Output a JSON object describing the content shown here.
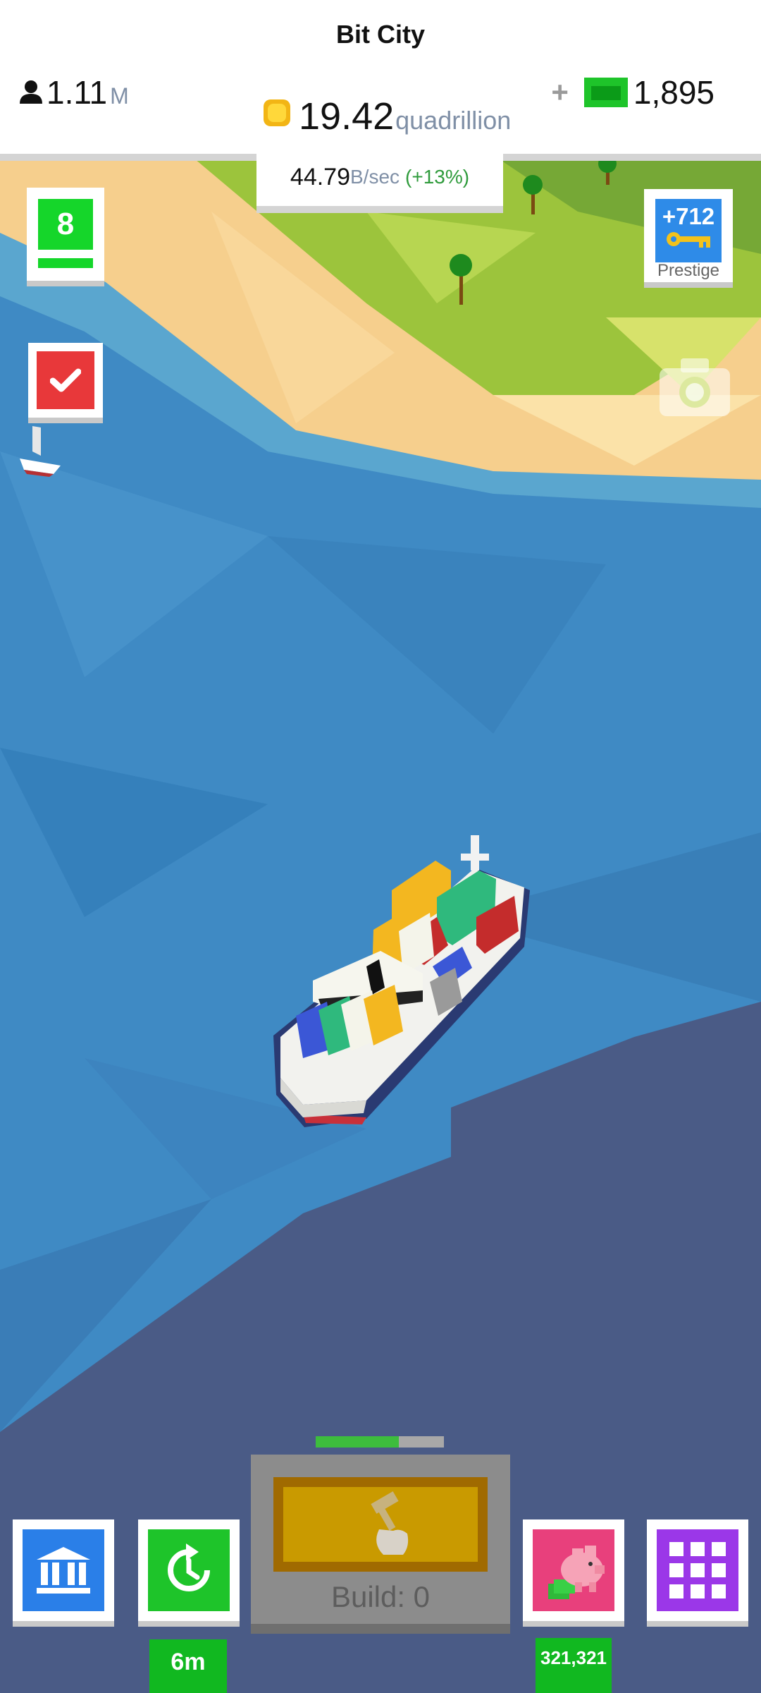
{
  "header": {
    "city_name": "Bit City",
    "population": {
      "value": "1.11",
      "unit": "M"
    },
    "coins": {
      "value": "19.42",
      "unit": "quadrillion"
    },
    "income": {
      "value": "44.79",
      "unit": "B/sec",
      "bonus": "(+13%)"
    },
    "bux": {
      "plus": "+",
      "value": "1,895"
    }
  },
  "left_buttons": {
    "level": "8",
    "level_progress": 1.0
  },
  "right_buttons": {
    "prestige_amount": "+712",
    "prestige_label": "Prestige"
  },
  "bottom_bar": {
    "build_label": "Build: 0",
    "build_progress": 0.65,
    "time_label": "6m",
    "piggy_label": "321,321"
  },
  "icons": [
    "person-icon",
    "coin-icon",
    "cash-icon",
    "check-icon",
    "key-icon",
    "camera-icon",
    "bank-icon",
    "time-warp-icon",
    "hammer-icon",
    "piggy-bank-icon",
    "grid-icon"
  ],
  "colors": {
    "water": "#3f8ac4",
    "deep": "#4a5b86",
    "sand": "#f6cf8d",
    "grass": "#9cc43c",
    "accent_green": "#15d62a"
  }
}
